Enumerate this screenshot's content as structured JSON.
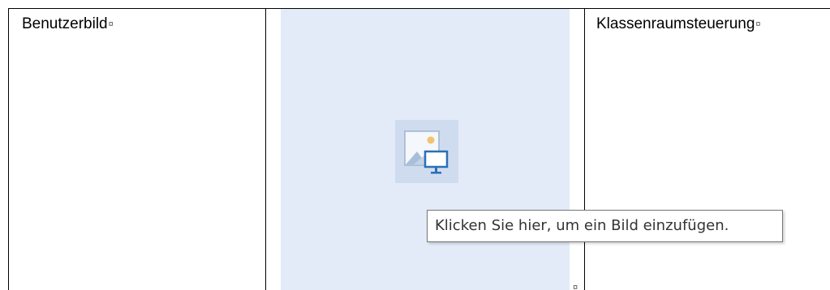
{
  "table": {
    "left_cell": {
      "label": "Benutzerbild",
      "mark": "¤"
    },
    "middle_cell": {
      "placeholder_icon": "insert-picture-icon",
      "end_mark": "¤"
    },
    "right_cell": {
      "label": "Klassenraumsteuerung",
      "mark": "¤"
    }
  },
  "tooltip": {
    "text": "Klicken Sie hier, um ein Bild einzufügen."
  },
  "colors": {
    "placeholder_background": "#e3ebf8",
    "icon_background": "#cfdcef",
    "icon_blue": "#2b6fb6",
    "icon_sun": "#f4c36b",
    "border": "#000000"
  }
}
